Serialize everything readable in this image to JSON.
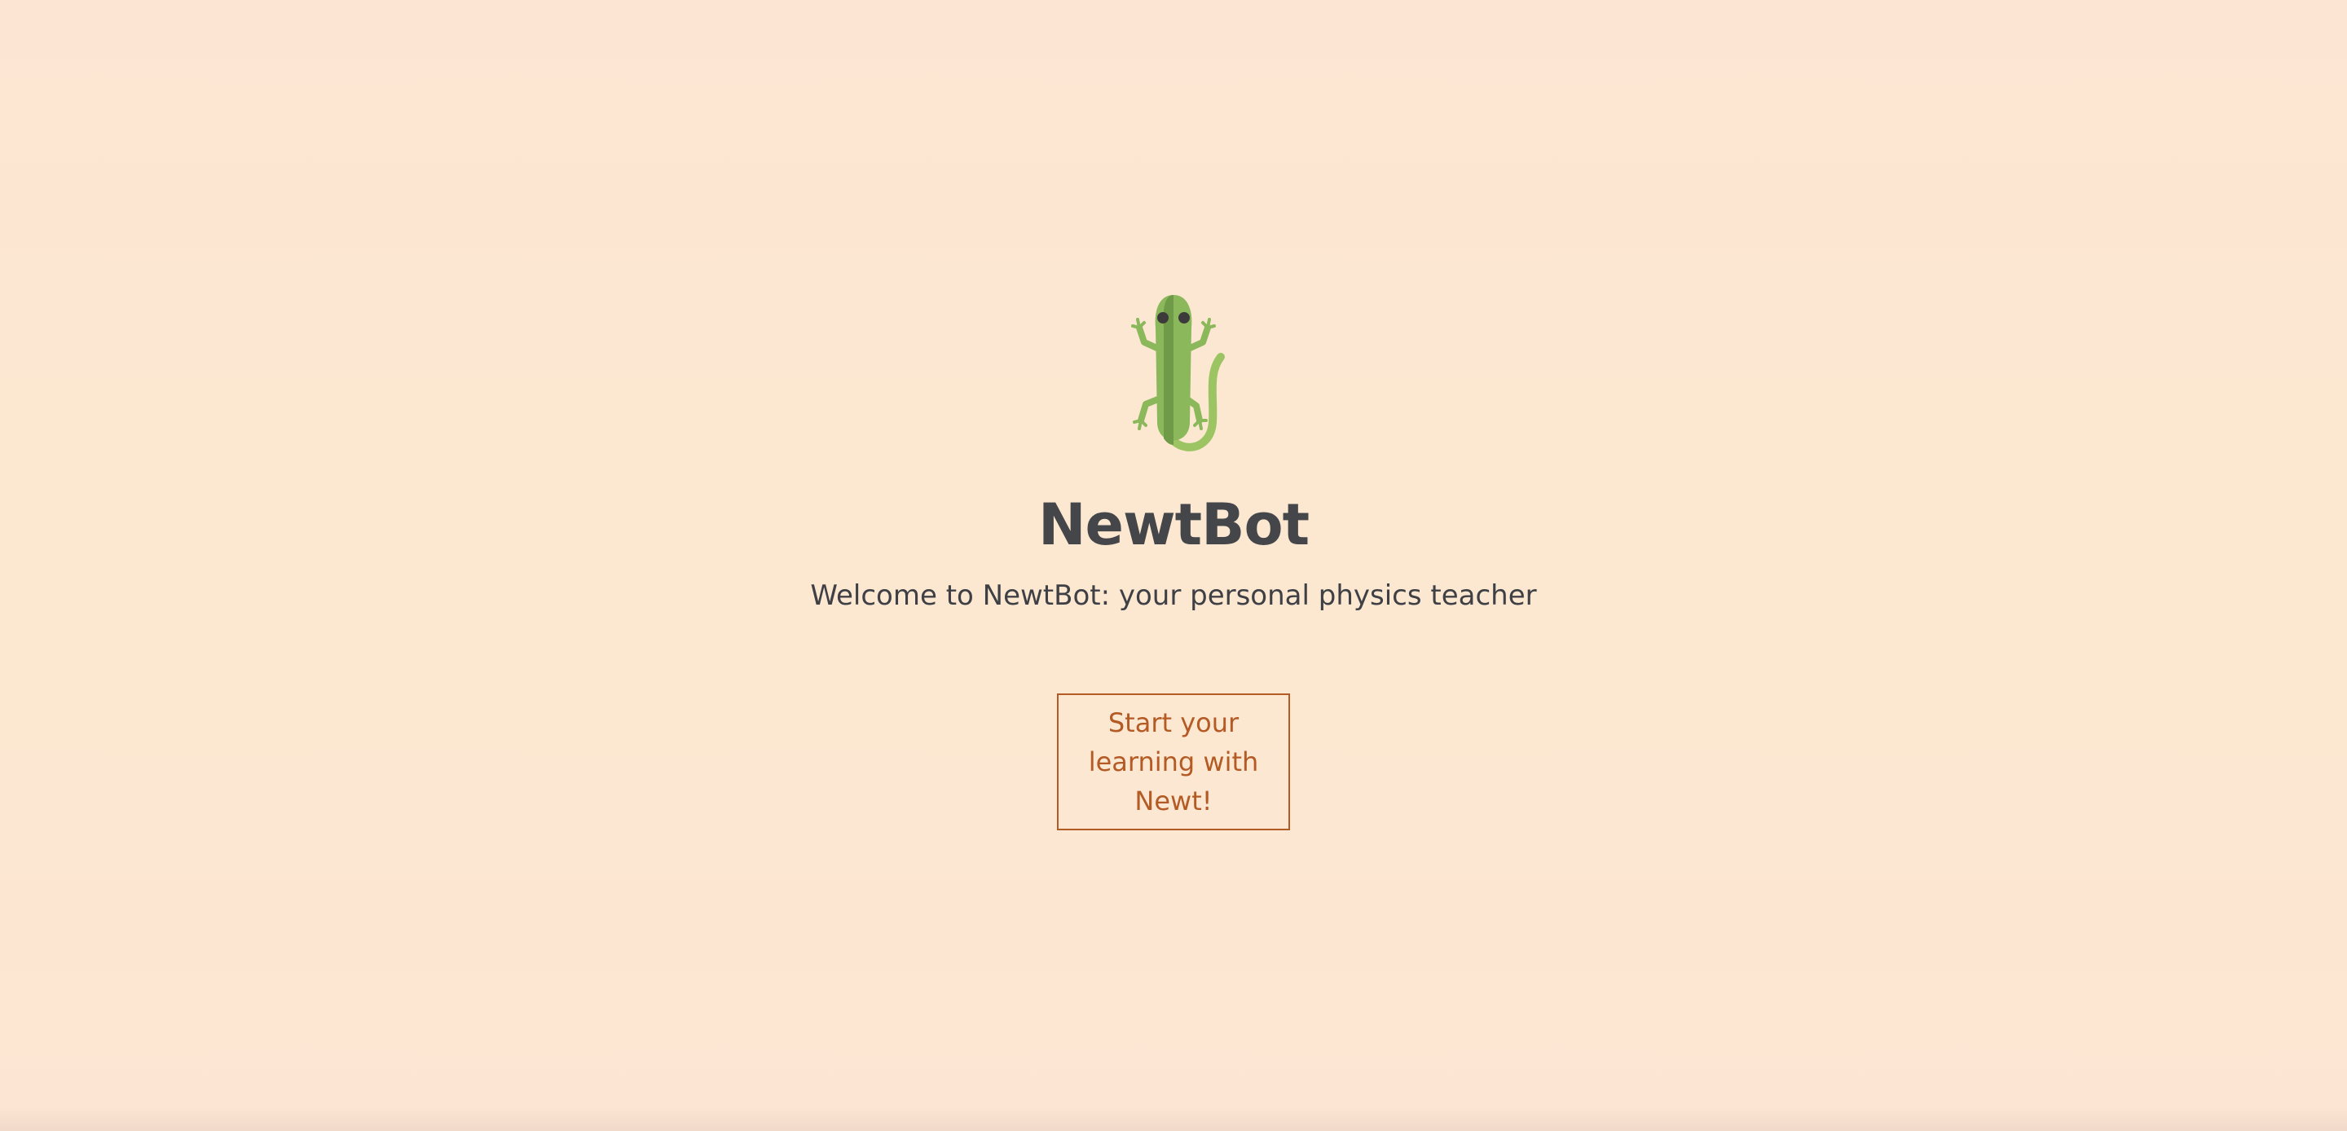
{
  "app": {
    "name": "NewtBot",
    "subtitle": "Welcome to NewtBot: your personal physics teacher",
    "logo_icon": "newt-lizard-icon"
  },
  "cta": {
    "label": "Start your learning with Newt!"
  },
  "colors": {
    "background": "#fce8d1",
    "title": "#45464a",
    "accent": "#b45a24",
    "newt_green": "#8bb85a",
    "newt_dark_green": "#6f9a48",
    "eye": "#3d3a3c"
  }
}
